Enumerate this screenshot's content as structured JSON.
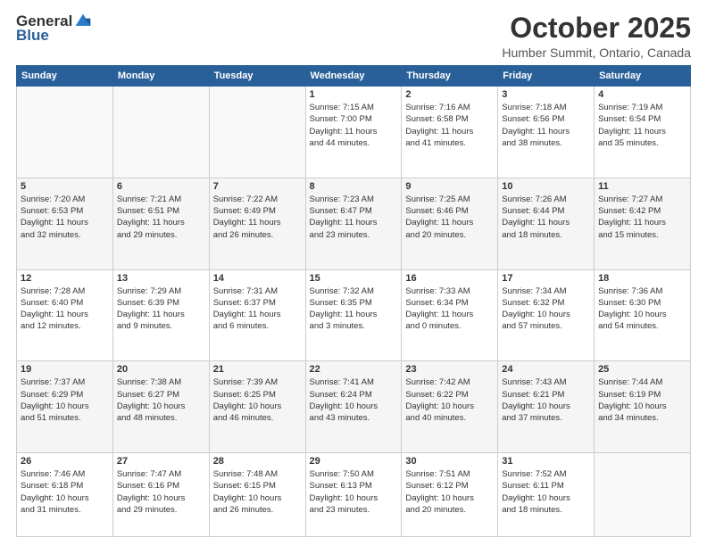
{
  "header": {
    "logo_general": "General",
    "logo_blue": "Blue",
    "month": "October 2025",
    "location": "Humber Summit, Ontario, Canada"
  },
  "days_of_week": [
    "Sunday",
    "Monday",
    "Tuesday",
    "Wednesday",
    "Thursday",
    "Friday",
    "Saturday"
  ],
  "weeks": [
    [
      {
        "day": "",
        "info": ""
      },
      {
        "day": "",
        "info": ""
      },
      {
        "day": "",
        "info": ""
      },
      {
        "day": "1",
        "info": "Sunrise: 7:15 AM\nSunset: 7:00 PM\nDaylight: 11 hours\nand 44 minutes."
      },
      {
        "day": "2",
        "info": "Sunrise: 7:16 AM\nSunset: 6:58 PM\nDaylight: 11 hours\nand 41 minutes."
      },
      {
        "day": "3",
        "info": "Sunrise: 7:18 AM\nSunset: 6:56 PM\nDaylight: 11 hours\nand 38 minutes."
      },
      {
        "day": "4",
        "info": "Sunrise: 7:19 AM\nSunset: 6:54 PM\nDaylight: 11 hours\nand 35 minutes."
      }
    ],
    [
      {
        "day": "5",
        "info": "Sunrise: 7:20 AM\nSunset: 6:53 PM\nDaylight: 11 hours\nand 32 minutes."
      },
      {
        "day": "6",
        "info": "Sunrise: 7:21 AM\nSunset: 6:51 PM\nDaylight: 11 hours\nand 29 minutes."
      },
      {
        "day": "7",
        "info": "Sunrise: 7:22 AM\nSunset: 6:49 PM\nDaylight: 11 hours\nand 26 minutes."
      },
      {
        "day": "8",
        "info": "Sunrise: 7:23 AM\nSunset: 6:47 PM\nDaylight: 11 hours\nand 23 minutes."
      },
      {
        "day": "9",
        "info": "Sunrise: 7:25 AM\nSunset: 6:46 PM\nDaylight: 11 hours\nand 20 minutes."
      },
      {
        "day": "10",
        "info": "Sunrise: 7:26 AM\nSunset: 6:44 PM\nDaylight: 11 hours\nand 18 minutes."
      },
      {
        "day": "11",
        "info": "Sunrise: 7:27 AM\nSunset: 6:42 PM\nDaylight: 11 hours\nand 15 minutes."
      }
    ],
    [
      {
        "day": "12",
        "info": "Sunrise: 7:28 AM\nSunset: 6:40 PM\nDaylight: 11 hours\nand 12 minutes."
      },
      {
        "day": "13",
        "info": "Sunrise: 7:29 AM\nSunset: 6:39 PM\nDaylight: 11 hours\nand 9 minutes."
      },
      {
        "day": "14",
        "info": "Sunrise: 7:31 AM\nSunset: 6:37 PM\nDaylight: 11 hours\nand 6 minutes."
      },
      {
        "day": "15",
        "info": "Sunrise: 7:32 AM\nSunset: 6:35 PM\nDaylight: 11 hours\nand 3 minutes."
      },
      {
        "day": "16",
        "info": "Sunrise: 7:33 AM\nSunset: 6:34 PM\nDaylight: 11 hours\nand 0 minutes."
      },
      {
        "day": "17",
        "info": "Sunrise: 7:34 AM\nSunset: 6:32 PM\nDaylight: 10 hours\nand 57 minutes."
      },
      {
        "day": "18",
        "info": "Sunrise: 7:36 AM\nSunset: 6:30 PM\nDaylight: 10 hours\nand 54 minutes."
      }
    ],
    [
      {
        "day": "19",
        "info": "Sunrise: 7:37 AM\nSunset: 6:29 PM\nDaylight: 10 hours\nand 51 minutes."
      },
      {
        "day": "20",
        "info": "Sunrise: 7:38 AM\nSunset: 6:27 PM\nDaylight: 10 hours\nand 48 minutes."
      },
      {
        "day": "21",
        "info": "Sunrise: 7:39 AM\nSunset: 6:25 PM\nDaylight: 10 hours\nand 46 minutes."
      },
      {
        "day": "22",
        "info": "Sunrise: 7:41 AM\nSunset: 6:24 PM\nDaylight: 10 hours\nand 43 minutes."
      },
      {
        "day": "23",
        "info": "Sunrise: 7:42 AM\nSunset: 6:22 PM\nDaylight: 10 hours\nand 40 minutes."
      },
      {
        "day": "24",
        "info": "Sunrise: 7:43 AM\nSunset: 6:21 PM\nDaylight: 10 hours\nand 37 minutes."
      },
      {
        "day": "25",
        "info": "Sunrise: 7:44 AM\nSunset: 6:19 PM\nDaylight: 10 hours\nand 34 minutes."
      }
    ],
    [
      {
        "day": "26",
        "info": "Sunrise: 7:46 AM\nSunset: 6:18 PM\nDaylight: 10 hours\nand 31 minutes."
      },
      {
        "day": "27",
        "info": "Sunrise: 7:47 AM\nSunset: 6:16 PM\nDaylight: 10 hours\nand 29 minutes."
      },
      {
        "day": "28",
        "info": "Sunrise: 7:48 AM\nSunset: 6:15 PM\nDaylight: 10 hours\nand 26 minutes."
      },
      {
        "day": "29",
        "info": "Sunrise: 7:50 AM\nSunset: 6:13 PM\nDaylight: 10 hours\nand 23 minutes."
      },
      {
        "day": "30",
        "info": "Sunrise: 7:51 AM\nSunset: 6:12 PM\nDaylight: 10 hours\nand 20 minutes."
      },
      {
        "day": "31",
        "info": "Sunrise: 7:52 AM\nSunset: 6:11 PM\nDaylight: 10 hours\nand 18 minutes."
      },
      {
        "day": "",
        "info": ""
      }
    ]
  ]
}
